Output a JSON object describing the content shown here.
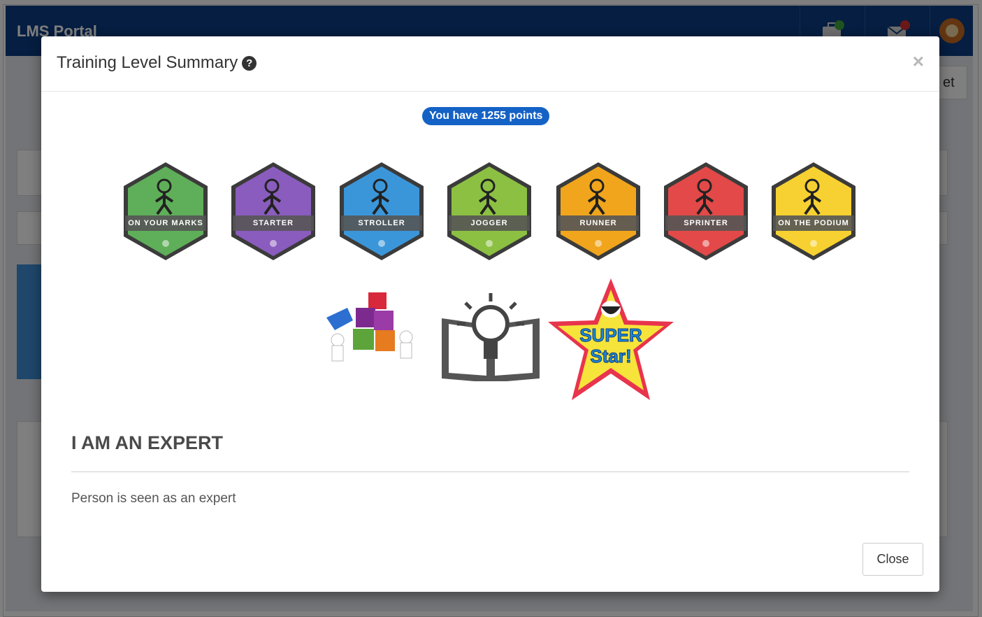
{
  "app": {
    "brand": "LMS Portal"
  },
  "modal": {
    "title": "Training Level Summary",
    "help_icon": "?",
    "close_icon": "×",
    "points_text": "You have 1255 points",
    "badges": [
      {
        "label": "ON YOUR MARKS",
        "color": "#5fae59"
      },
      {
        "label": "STARTER",
        "color": "#8a5cbd"
      },
      {
        "label": "STROLLER",
        "color": "#3b96d9"
      },
      {
        "label": "JOGGER",
        "color": "#8cc043"
      },
      {
        "label": "RUNNER",
        "color": "#f0a51c"
      },
      {
        "label": "SPRINTER",
        "color": "#e24948"
      },
      {
        "label": "ON THE PODIUM",
        "color": "#f6d131"
      }
    ],
    "awards": [
      {
        "name": "puzzle-teamwork-award"
      },
      {
        "name": "lightbulb-book-award"
      },
      {
        "name": "super-star-award",
        "line1": "SUPER",
        "line2": "Star!"
      }
    ],
    "selected_heading": "I AM AN EXPERT",
    "selected_description": "Person is seen as an expert",
    "close_button": "Close"
  },
  "background": {
    "partial_button": "et"
  }
}
